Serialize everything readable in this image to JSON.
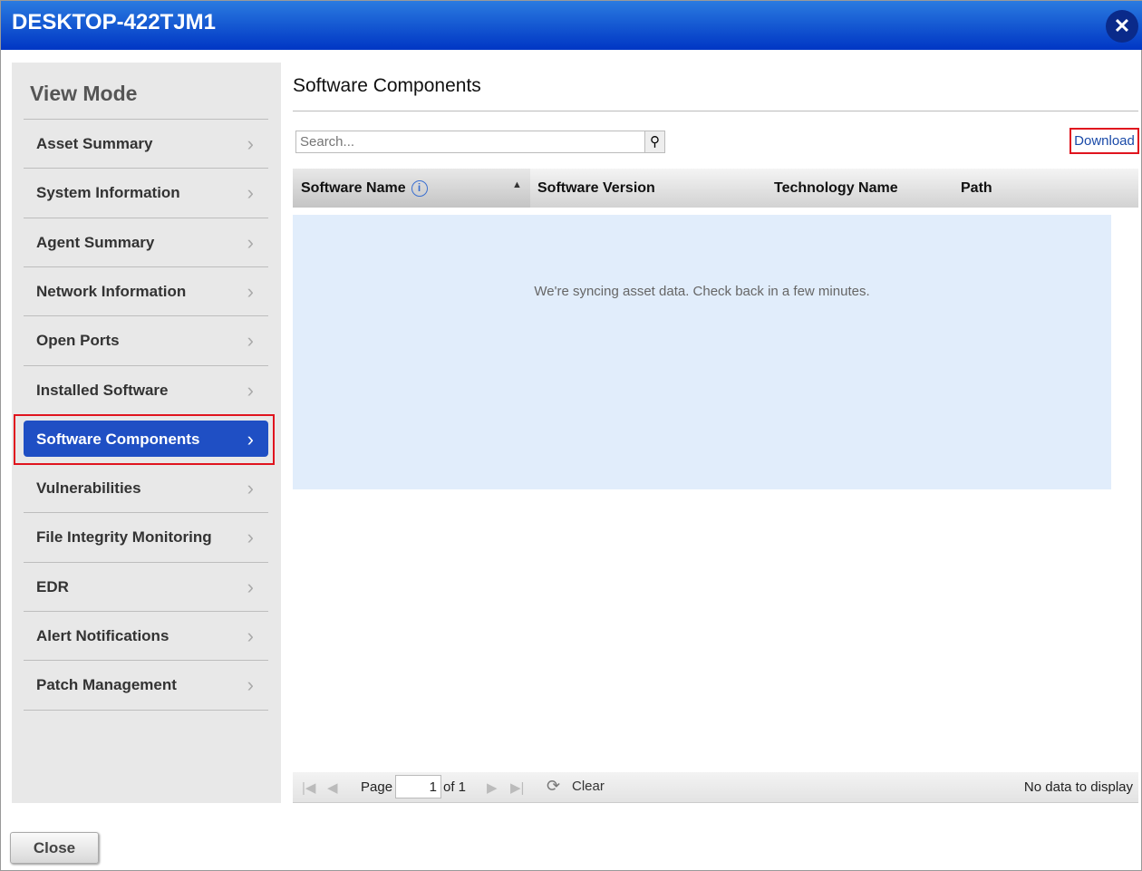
{
  "window": {
    "title": "DESKTOP-422TJM1",
    "close_icon": "close-icon"
  },
  "sidebar": {
    "heading": "View Mode",
    "items": [
      {
        "label": "Asset Summary"
      },
      {
        "label": "System Information"
      },
      {
        "label": "Agent Summary"
      },
      {
        "label": "Network Information"
      },
      {
        "label": "Open Ports"
      },
      {
        "label": "Installed Software"
      },
      {
        "label": "Software Components",
        "active": true
      },
      {
        "label": "Vulnerabilities"
      },
      {
        "label": "File Integrity Monitoring"
      },
      {
        "label": "EDR"
      },
      {
        "label": "Alert Notifications"
      },
      {
        "label": "Patch Management"
      }
    ]
  },
  "main": {
    "title": "Software Components",
    "search_placeholder": "Search...",
    "download": "Download",
    "columns": [
      "Software Name",
      "Software Version",
      "Technology Name",
      "Path"
    ],
    "empty_message": "We're syncing asset data. Check back in a few minutes."
  },
  "pager": {
    "page_label": "Page",
    "page": "1",
    "of": "of 1",
    "clear": "Clear",
    "status": "No data to display"
  },
  "footer": {
    "close": "Close"
  }
}
